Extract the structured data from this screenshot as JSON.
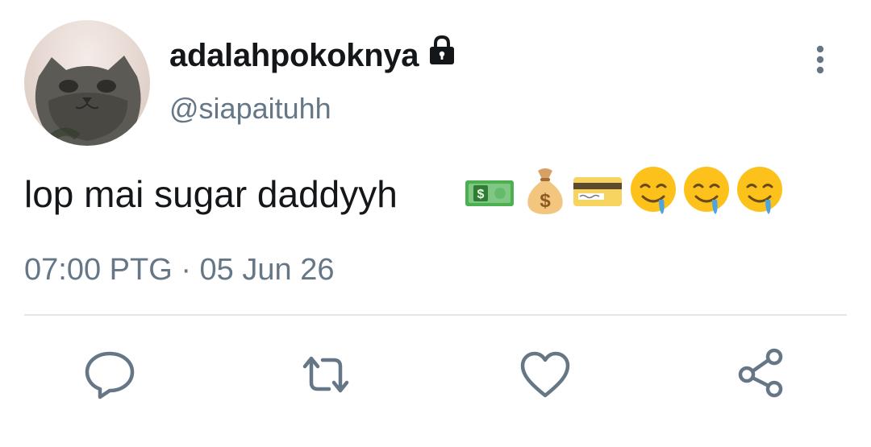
{
  "tweet": {
    "author": {
      "display_name": "adalahpokoknya",
      "handle": "@siapaituhh",
      "avatar_icon": "cat-face-avatar",
      "protected_icon": "lock-icon"
    },
    "text": "lop mai sugar daddyyh",
    "emojis": [
      "dollar-banknote-emoji",
      "money-bag-emoji",
      "credit-card-emoji",
      "drooling-face-emoji",
      "drooling-face-emoji",
      "drooling-face-emoji"
    ],
    "time": "07:00 PTG",
    "separator": "·",
    "date": "05 Jun 26"
  },
  "actions": [
    {
      "name": "reply",
      "icon": "reply-icon"
    },
    {
      "name": "retweet",
      "icon": "retweet-icon"
    },
    {
      "name": "like",
      "icon": "heart-icon"
    },
    {
      "name": "share",
      "icon": "share-icon"
    }
  ],
  "colors": {
    "primary_text": "#14171a",
    "secondary_text": "#657786",
    "divider": "#e1e8ed"
  }
}
